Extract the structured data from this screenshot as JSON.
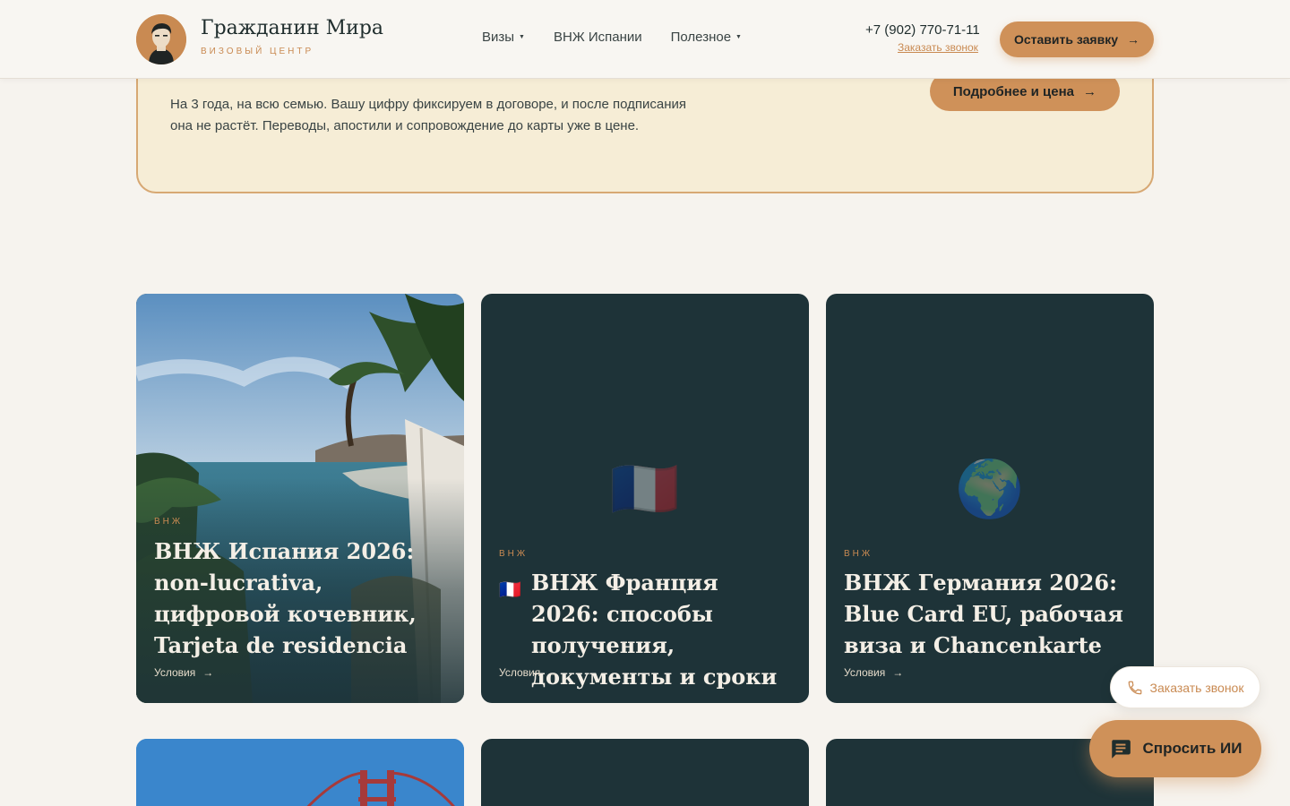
{
  "header": {
    "brand_name": "Гражданин Мира",
    "brand_sub": "ВИЗОВЫЙ ЦЕНТР",
    "nav": [
      {
        "label": "Визы",
        "has_dropdown": true
      },
      {
        "label": "ВНЖ Испании",
        "has_dropdown": false
      },
      {
        "label": "Полезное",
        "has_dropdown": true
      }
    ],
    "phone": "+7 (902) 770-71-11",
    "callback_link": "Заказать звонок",
    "cta_label": "Оставить заявку"
  },
  "promo": {
    "text": "На 3 года, на всю семью. Вашу цифру фиксируем в договоре, и после подписания она не растёт. Переводы, апостили и сопровождение до карты уже в цене.",
    "button_label": "Подробнее и цена"
  },
  "cards": [
    {
      "tag": "ВНЖ",
      "title": "ВНЖ Испания 2026: non-lucrativa, цифровой кочевник, Tarjeta de residencia",
      "link": "Условия",
      "flag": "",
      "emblem": ""
    },
    {
      "tag": "ВНЖ",
      "title": "ВНЖ Франция 2026: способы получения, документы и сроки",
      "link": "Условия",
      "flag": "🇫🇷",
      "emblem": "🇫🇷"
    },
    {
      "tag": "ВНЖ",
      "title": "ВНЖ Германия 2026: Blue Card EU, рабочая виза и Chancenkarte",
      "link": "Условия",
      "flag": "",
      "emblem": "🌍"
    }
  ],
  "floating": {
    "call_label": "Заказать звонок",
    "ai_label": "Спросить ИИ"
  },
  "colors": {
    "accent": "#cf9159",
    "accent_text": "#c98a52",
    "card_bg": "#1e3338",
    "page_bg": "#f6f3ee",
    "promo_bg": "#f6edd6"
  }
}
